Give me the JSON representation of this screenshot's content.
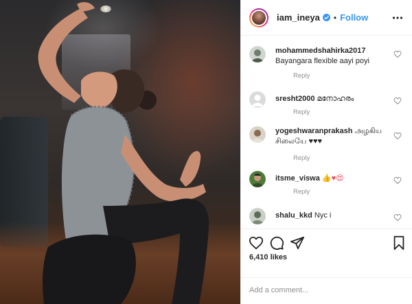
{
  "post": {
    "author": "iam_ineya",
    "separator": "•",
    "follow_label": "Follow",
    "likes": "6,410 likes",
    "add_comment_placeholder": "Add a comment..."
  },
  "comments": [
    {
      "user": "mohammedshahirka2017",
      "text": "Bayangara flexible aayi poyi",
      "reply": "Reply"
    },
    {
      "user": "sresht2000",
      "text": "മനോഹരം",
      "reply": "Reply"
    },
    {
      "user": "yogeshwaranprakash",
      "text": "அழகிய சிலையே ♥♥♥",
      "reply": "Reply"
    },
    {
      "user": "itsme_viswa",
      "text": "👍♥😍",
      "reply": "Reply"
    },
    {
      "user": "shalu_kkd",
      "text": "Nyc i",
      "reply": ""
    }
  ],
  "icons": {
    "verified": "verified-badge-icon",
    "more": "more-options-icon",
    "like": "heart-icon",
    "comment": "comment-icon",
    "share": "share-icon",
    "save": "bookmark-icon"
  },
  "colors": {
    "accent": "#3897f0",
    "text": "#262626",
    "muted": "#8e8e8e",
    "border": "#efefef",
    "heart_red": "#ed4956"
  }
}
